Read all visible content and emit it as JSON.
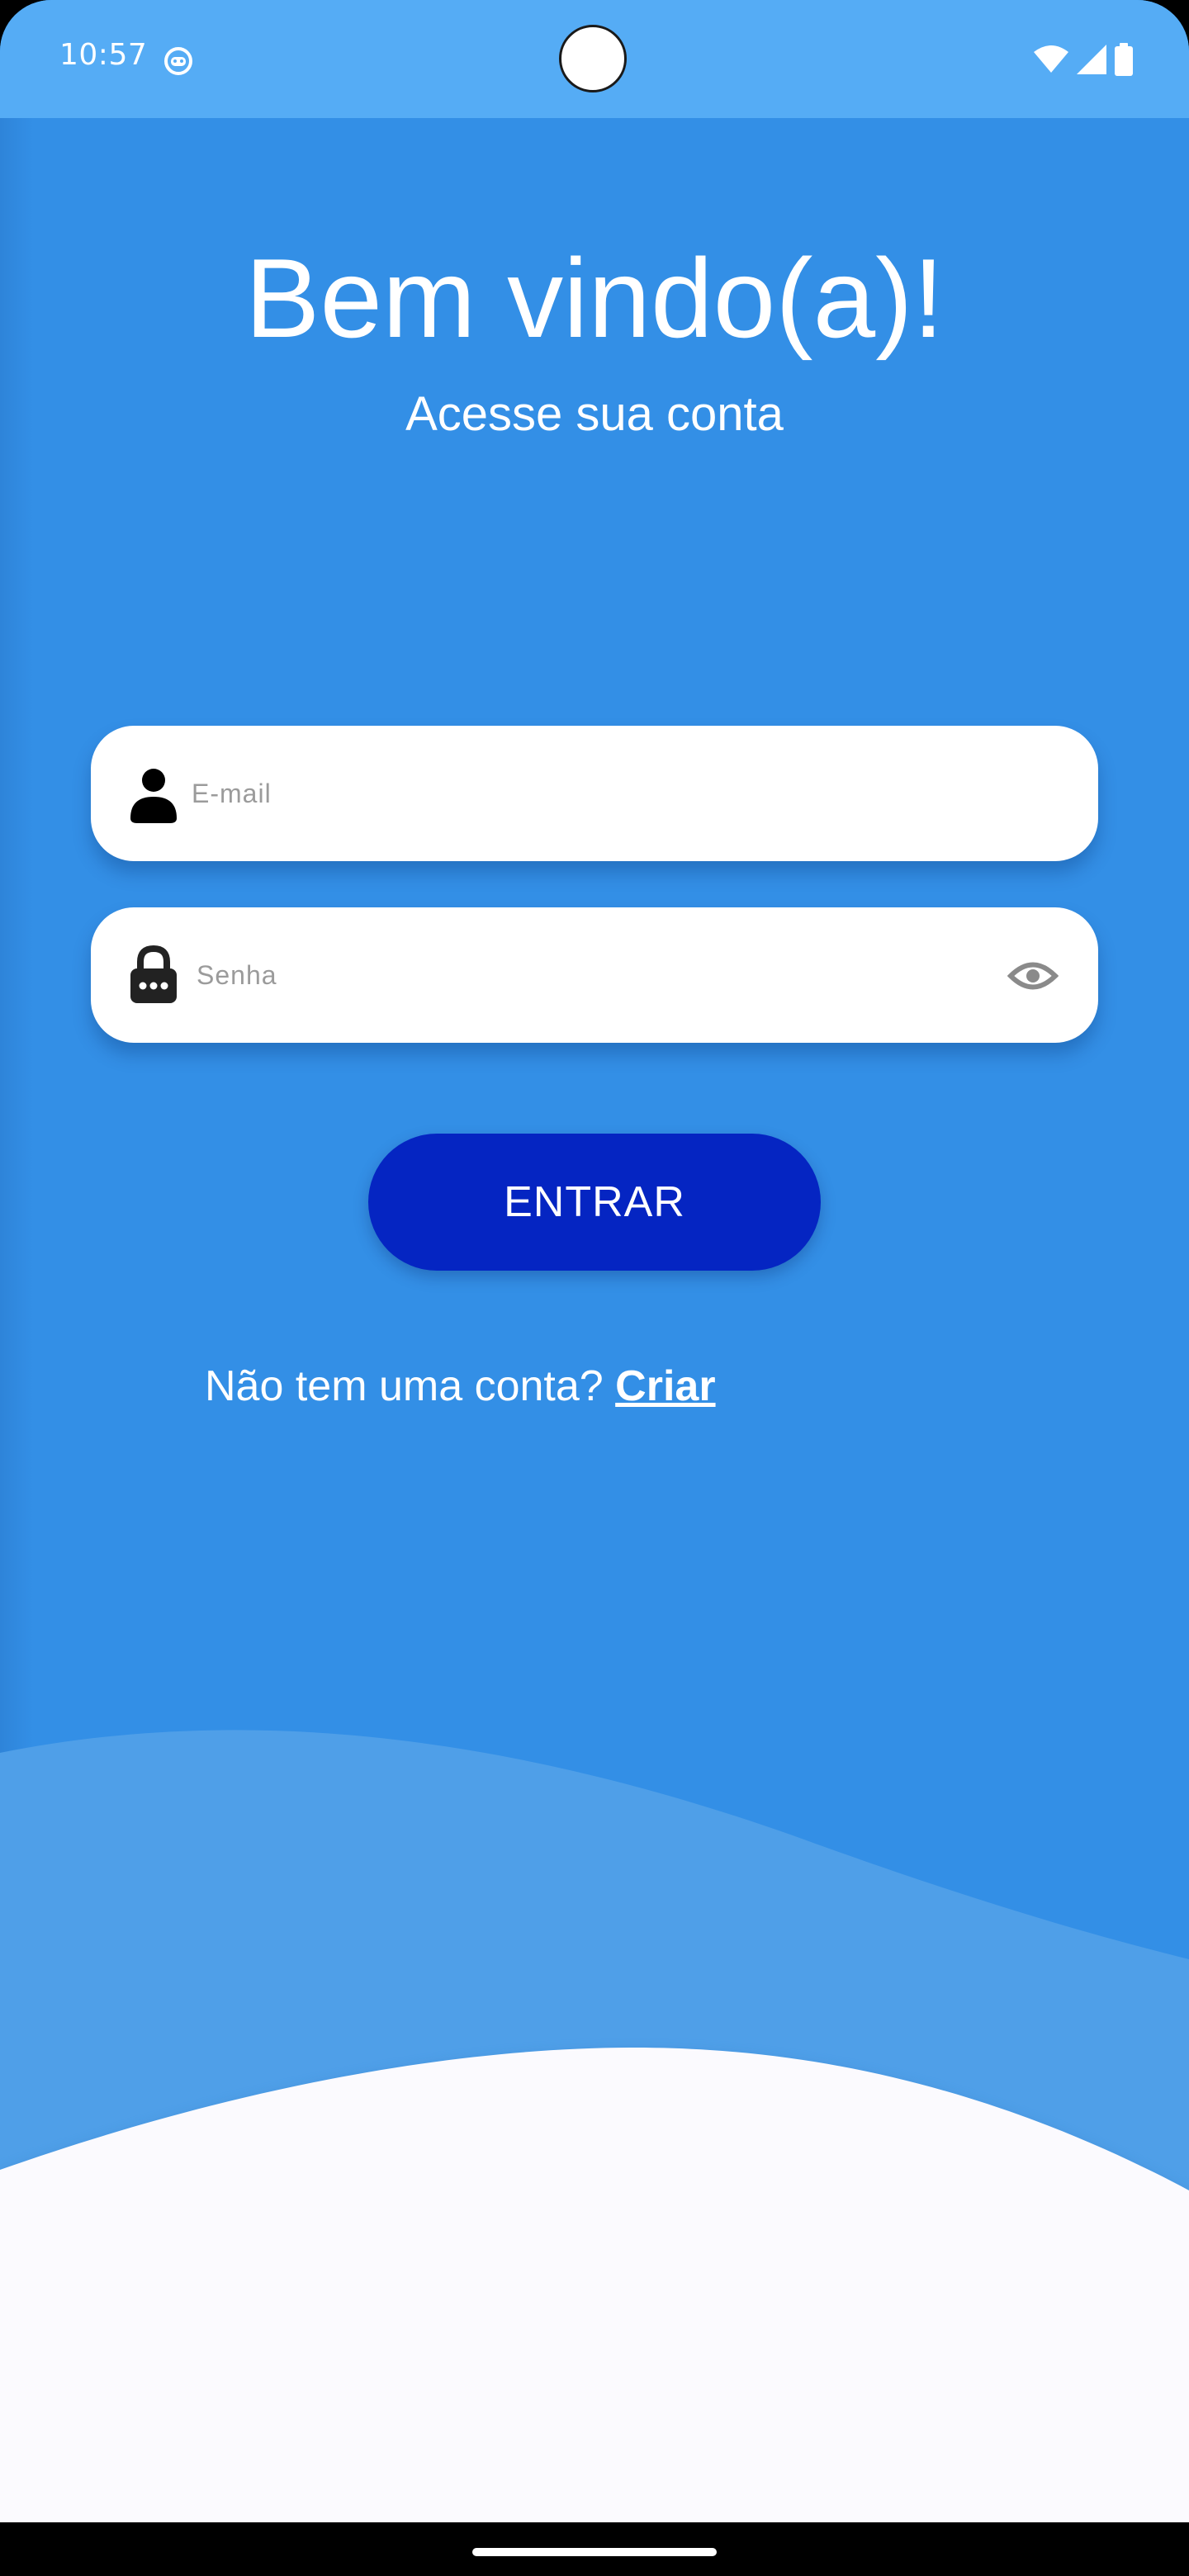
{
  "status_bar": {
    "time": "10:57",
    "app_icon": "android-debug-icon",
    "indicators": [
      "wifi-icon",
      "signal-icon",
      "battery-icon"
    ]
  },
  "login": {
    "title": "Bem vindo(a)!",
    "subtitle": "Acesse sua conta",
    "email": {
      "placeholder": "E-mail",
      "value": "",
      "icon": "person-icon"
    },
    "password": {
      "placeholder": "Senha",
      "value": "",
      "icon": "lock-icon",
      "toggle_icon": "eye-icon"
    },
    "submit_label": "ENTRAR",
    "signup_prompt": "Não tem uma conta?",
    "signup_link": "Criar"
  },
  "colors": {
    "status_bar": "#55acf5",
    "background": "#338fe6",
    "wave_light": "#4f9fe8",
    "wave_white": "#fbfafe",
    "button": "#0525c2",
    "text": "#ffffff"
  }
}
